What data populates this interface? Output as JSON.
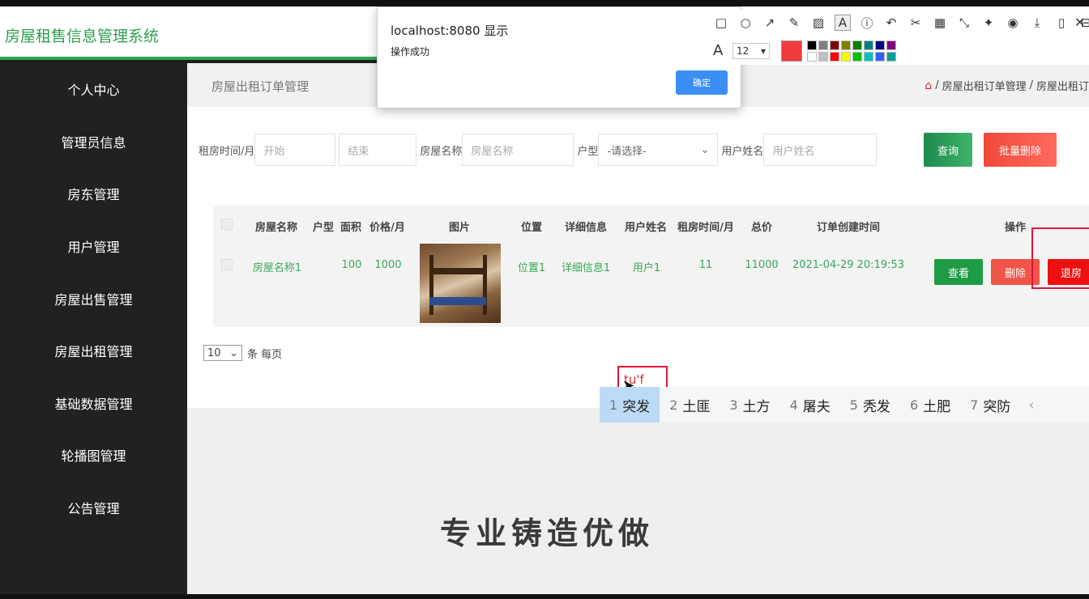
{
  "header": {
    "title": "房屋租售信息管理系统"
  },
  "sidebar": {
    "items": [
      {
        "label": "个人中心"
      },
      {
        "label": "管理员信息"
      },
      {
        "label": "房东管理"
      },
      {
        "label": "用户管理"
      },
      {
        "label": "房屋出售管理"
      },
      {
        "label": "房屋出租管理"
      },
      {
        "label": "基础数据管理"
      },
      {
        "label": "轮播图管理"
      },
      {
        "label": "公告管理"
      }
    ]
  },
  "page": {
    "title": "房屋出租订单管理",
    "breadcrumb": [
      "房屋出租订单管理",
      "房屋出租订"
    ]
  },
  "search": {
    "rent_time_label": "租房时间/月",
    "start_placeholder": "开始",
    "end_placeholder": "结束",
    "house_name_label": "房屋名称",
    "house_name_placeholder": "房屋名称",
    "type_label": "户型",
    "type_selected": "-请选择-",
    "user_name_label": "用户姓名",
    "user_name_placeholder": "用户姓名",
    "query_button": "查询",
    "batch_delete_button": "批量删除"
  },
  "table": {
    "headers": [
      "房屋名称",
      "户型",
      "面积",
      "价格/月",
      "图片",
      "位置",
      "详细信息",
      "用户姓名",
      "租房时间/月",
      "总价",
      "订单创建时间",
      "操作"
    ],
    "rows": [
      {
        "house_name": "房屋名称1",
        "type": "",
        "area": "100",
        "price": "1000",
        "location": "位置1",
        "detail": "详细信息1",
        "user": "用户1",
        "months": "11",
        "total": "11000",
        "created": "2021-04-29 20:19:53"
      }
    ],
    "actions": {
      "view": "查看",
      "delete": "删除",
      "checkout": "退房"
    }
  },
  "pager": {
    "page_size": "10",
    "per_page_label": "条 每页"
  },
  "banner": {
    "text": "专业铸造优做"
  },
  "dialog": {
    "title": "localhost:8080 显示",
    "message": "操作成功",
    "ok": "确定"
  },
  "annotation_toolbar": {
    "font_size": "12",
    "current_color": "#f03c3c",
    "palette": [
      "#000000",
      "#808080",
      "#800000",
      "#808000",
      "#008000",
      "#008080",
      "#000080",
      "#800080",
      "#ffffff",
      "#c0c0c0",
      "#ff0000",
      "#ffff00",
      "#00c000",
      "#00c0c0",
      "#3060ff",
      "#00a0a0"
    ]
  },
  "ime": {
    "composition": "tu'f",
    "candidates": [
      {
        "n": "1",
        "text": "突发"
      },
      {
        "n": "2",
        "text": "土匪"
      },
      {
        "n": "3",
        "text": "土方"
      },
      {
        "n": "4",
        "text": "屠夫"
      },
      {
        "n": "5",
        "text": "秃发"
      },
      {
        "n": "6",
        "text": "土肥"
      },
      {
        "n": "7",
        "text": "突防"
      }
    ]
  },
  "colors": {
    "brand_green": "#2e9e4f",
    "sidebar_bg": "#1f2220",
    "danger": "#f0483c"
  }
}
